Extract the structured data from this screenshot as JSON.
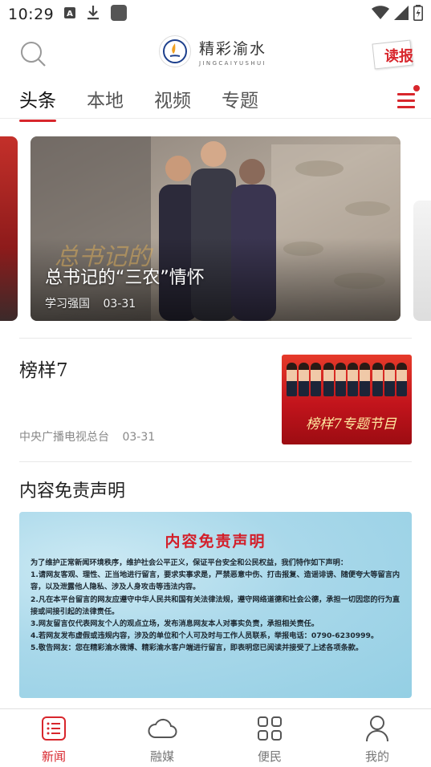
{
  "status_bar": {
    "time": "10:29",
    "icons": [
      "notification-a-icon",
      "download-icon",
      "app-square-icon",
      "wifi-icon",
      "signal-icon",
      "battery-icon"
    ]
  },
  "header": {
    "brand_name": "精彩渝水",
    "brand_pinyin": "JINGCAIYUSHUI",
    "read_paper_label": "读报"
  },
  "tabs": [
    {
      "label": "头条",
      "active": true
    },
    {
      "label": "本地",
      "active": false
    },
    {
      "label": "视频",
      "active": false
    },
    {
      "label": "专题",
      "active": false
    }
  ],
  "carousel": {
    "current": {
      "title": "总书记的“三农”情怀",
      "source": "学习强国",
      "date": "03-31"
    }
  },
  "news": [
    {
      "title": "榜样7",
      "source": "中央广播电视总台",
      "date": "03-31",
      "thumb_caption": "榜样7专题节目"
    }
  ],
  "notice_section": {
    "heading": "内容免责声明",
    "image_title": "内容免责声明",
    "paragraphs": [
      "为了维护正常新闻环境秩序，维护社会公平正义，保证平台安全和公民权益，我们特作如下声明：",
      "1.请网友客观、理性、正当地进行留言，要求实事求是，严禁恶意中伤、打击报复、造谣诽谤、随便夸大等留言内容，以及泄露他人隐私、涉及人身攻击等违法内容。",
      "2.凡在本平台留言的网友应遵守中华人民共和国有关法律法规，遵守网络道德和社会公德，承担一切因您的行为直接或间接引起的法律责任。",
      "3.网友留言仅代表网友个人的观点立场，发布消息网友本人对事实负责，承担相关责任。",
      "4.若网友发布虚假或违规内容，涉及的单位和个人可及时与工作人员联系，举报电话：0790-6230999。",
      "5.敬告网友：您在精彩渝水微博、精彩渝水客户端进行留言，即表明您已阅读并接受了上述各项条款。"
    ]
  },
  "bottom_nav": [
    {
      "label": "新闻",
      "icon": "news-list-icon",
      "active": true
    },
    {
      "label": "融媒",
      "icon": "cloud-icon",
      "active": false
    },
    {
      "label": "便民",
      "icon": "grid-icon",
      "active": false
    },
    {
      "label": "我的",
      "icon": "person-icon",
      "active": false
    }
  ],
  "colors": {
    "accent": "#d8262c",
    "tab_active_text": "#111111",
    "muted_text": "#888888"
  }
}
